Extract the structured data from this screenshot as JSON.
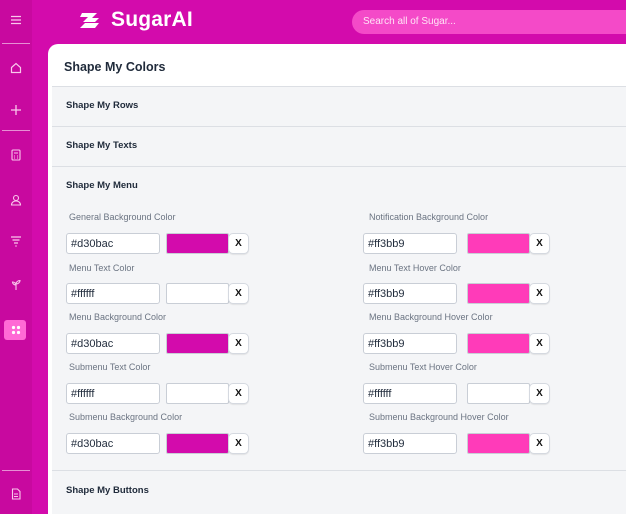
{
  "app": {
    "name": "SugarAI"
  },
  "search": {
    "placeholder": "Search all of Sugar..."
  },
  "page": {
    "title": "Shape My Colors"
  },
  "sections": {
    "rows": "Shape My Rows",
    "texts": "Shape My Texts",
    "menu": "Shape My Menu",
    "buttons": "Shape My Buttons"
  },
  "menu_fields": {
    "general_bg": {
      "label": "General Background Color",
      "value": "#d30bac",
      "color": "#d30bac"
    },
    "menu_text": {
      "label": "Menu Text Color",
      "value": "#ffffff",
      "color": "#ffffff"
    },
    "menu_bg": {
      "label": "Menu Background Color",
      "value": "#d30bac",
      "color": "#d30bac"
    },
    "submenu_text": {
      "label": "Submenu Text Color",
      "value": "#ffffff",
      "color": "#ffffff"
    },
    "submenu_bg": {
      "label": "Submenu Background Color",
      "value": "#d30bac",
      "color": "#d30bac"
    },
    "notification_bg": {
      "label": "Notification Background Color",
      "value": "#ff3bb9",
      "color": "#ff3bb9"
    },
    "menu_text_hover": {
      "label": "Menu Text Hover Color",
      "value": "#ff3bb9",
      "color": "#ff3bb9"
    },
    "menu_bg_hover": {
      "label": "Menu Background Hover Color",
      "value": "#ff3bb9",
      "color": "#ff3bb9"
    },
    "submenu_text_hover": {
      "label": "Submenu Text Hover Color",
      "value": "#ffffff",
      "color": "#ffffff"
    },
    "submenu_bg_hover": {
      "label": "Submenu Background Hover Color",
      "value": "#ff3bb9",
      "color": "#ff3bb9"
    }
  },
  "clear_label": "X",
  "colors": {
    "brand": "#d30bac",
    "accent": "#ff3bb9",
    "sidebar": "#c8099f"
  },
  "sidebar_icons": [
    "menu-icon",
    "home-icon",
    "plus-icon",
    "calculator-icon",
    "user-icon",
    "filter-icon",
    "plant-icon",
    "apps-grid-icon",
    "document-icon"
  ]
}
